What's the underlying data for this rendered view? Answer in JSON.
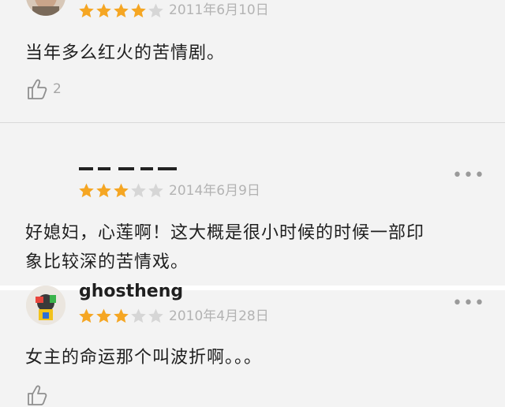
{
  "colors": {
    "star_on": "#f5a623",
    "star_off": "#d6d6d6",
    "text": "#1f1f1f",
    "muted": "#b3b3b3"
  },
  "reviews": [
    {
      "rating": 4,
      "date": "2011年6月10日",
      "content": "当年多么红火的苦情剧。",
      "likes": "2",
      "avatar_icon": "user-photo-avatar"
    },
    {
      "user": "",
      "rating": 3,
      "date": "2014年6月9日",
      "content_line1": "好媳妇，心莲啊！这大概是很小时候的时候一部印",
      "content_line2": "象比较深的苦情戏。",
      "more": "•••"
    },
    {
      "user": "ghostheng",
      "rating": 3,
      "date": "2010年4月28日",
      "content": "女主的命运那个叫波折啊。。。",
      "more": "•••",
      "avatar_icon": "cartoon-avatar"
    }
  ]
}
